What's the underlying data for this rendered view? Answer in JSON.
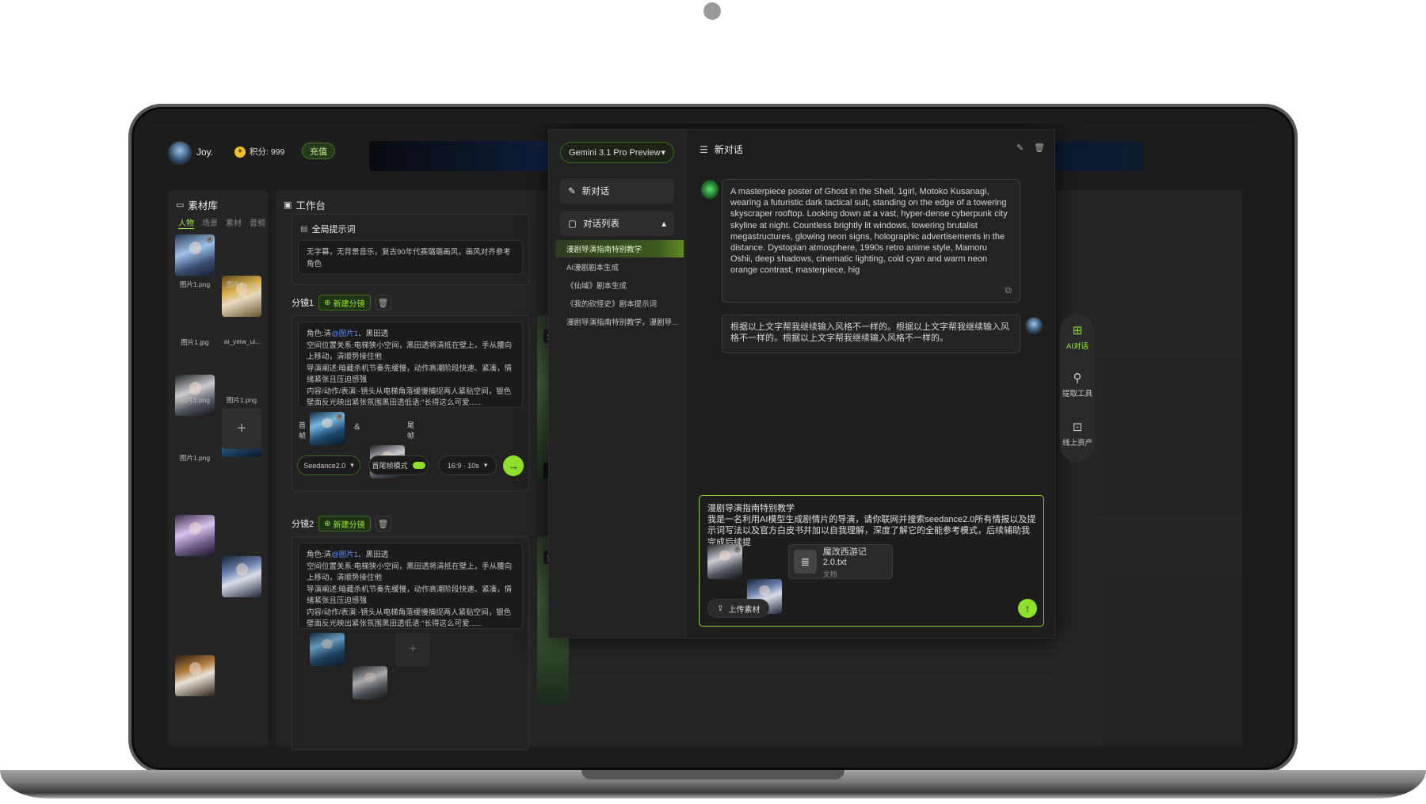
{
  "user": {
    "name": "Joy.",
    "points": "积分: 999",
    "recharge": "充值"
  },
  "library": {
    "title": "素材库",
    "tabs": [
      "人物",
      "场景",
      "素材",
      "音频"
    ],
    "items": [
      {
        "label": "图片1.png"
      },
      {
        "label": "图片1.png"
      },
      {
        "label": "图片1.jpg"
      },
      {
        "label": "ai_yeiw_ui..."
      },
      {
        "label": "图片1.png"
      },
      {
        "label": "图片1.png"
      },
      {
        "label": "图片1.png"
      }
    ],
    "add": "+"
  },
  "workspace": {
    "title": "工作台",
    "global_prompt_title": "全局提示词",
    "global_prompt": "无字幕，无背景音乐，复古90年代赛璐璐画风，画风对齐参考角色",
    "shots": [
      {
        "name": "分镜1",
        "new_shot": "新建分镜",
        "role_prefix": "角色:清",
        "role_link": "@图片1",
        "role_suffix": "、黑田透",
        "lines": [
          "空间位置关系:电梯狭小空间，黑田透将清抵在壁上，手从腰向上移动，清顺势接住他",
          "导演阐述:暗藏杀机节奏先缓慢，动作高潮阶段快速、紧凑，情绪紧张且压迫感强",
          "内容/动作/表演:-镜头从电梯角落缓慢捕捉两人紧贴空间，银色壁面反光映出紧张氛围黑田透低语:\"长得这么可爱......"
        ],
        "first_frame": "首帧",
        "last_frame": "尾帧",
        "amp": "&",
        "model": "Seedance2.0",
        "mode": "首尾帧模式",
        "ratio": "16:9 · 10s",
        "preview_tag": "分镜"
      },
      {
        "name": "分镜2",
        "new_shot": "新建分镜",
        "role_prefix": "角色:清",
        "role_link": "@图片1",
        "role_suffix": "、黑田透",
        "lines": [
          "空间位置关系:电梯狭小空间，黑田透将清抵在壁上，手从腰向上移动，清顺势接住他",
          "导演阐述:暗藏杀机节奏先缓慢，动作高潮阶段快速、紧凑，情绪紧张且压迫感强",
          "内容/动作/表演:-镜头从电梯角落缓慢捕捉两人紧贴空间，银色壁面反光映出紧张氛围黑田透低语:\"长得这么可爱......"
        ],
        "preview_tag": "分镜",
        "add": "+"
      }
    ]
  },
  "chat": {
    "model": "Gemini 3.1 Pro Preview",
    "new_chat": "新对话",
    "list_title": "对话列表",
    "conversations": [
      "漫剧导演指南特别教学",
      "AI漫剧剧本生成",
      "《仙域》剧本生成",
      "《我的砍怪史》剧本提示词",
      "漫剧导演指南特别教学，漫剧导..."
    ],
    "header_title": "新对话",
    "bot_message": "A masterpiece poster of Ghost in the Shell, 1girl, Motoko Kusanagi, wearing a futuristic dark tactical suit, standing on the edge of a towering skyscraper rooftop. Looking down at a vast, hyper-dense cyberpunk city skyline at night. Countless brightly lit windows, towering brutalist megastructures, glowing neon signs, holographic advertisements in the distance. Dystopian atmosphere, 1990s retro anime style, Mamoru Oshii, deep shadows, cinematic lighting, cold cyan and warm neon orange contrast, masterpiece, hig",
    "user_message": "根据以上文字帮我继续输入风格不一样的。根据以上文字帮我继续输入风格不一样的。根据以上文字帮我继续输入风格不一样的。",
    "input_title": "漫剧导演指南特别教学",
    "input_text": "我是一名利用AI模型生成剧情片的导演，请你联网并搜索seedance2.0所有情报以及提示词写法以及官方白皮书并加以自我理解，深度了解它的全能参考模式，后续辅助我完成后续提",
    "file_name": "魔改西游记2.0.txt",
    "file_type": "文档",
    "upload": "上传素材"
  },
  "rail": [
    {
      "label": "AI对话",
      "icon": "ai-chat-icon",
      "active": true
    },
    {
      "label": "提取工具",
      "icon": "extract-tool-icon",
      "active": false
    },
    {
      "label": "线上资产",
      "icon": "online-assets-icon",
      "active": false
    }
  ],
  "colors": {
    "accent": "#8fe02a",
    "link": "#5b8cff",
    "bg": "#1d1d1d"
  }
}
